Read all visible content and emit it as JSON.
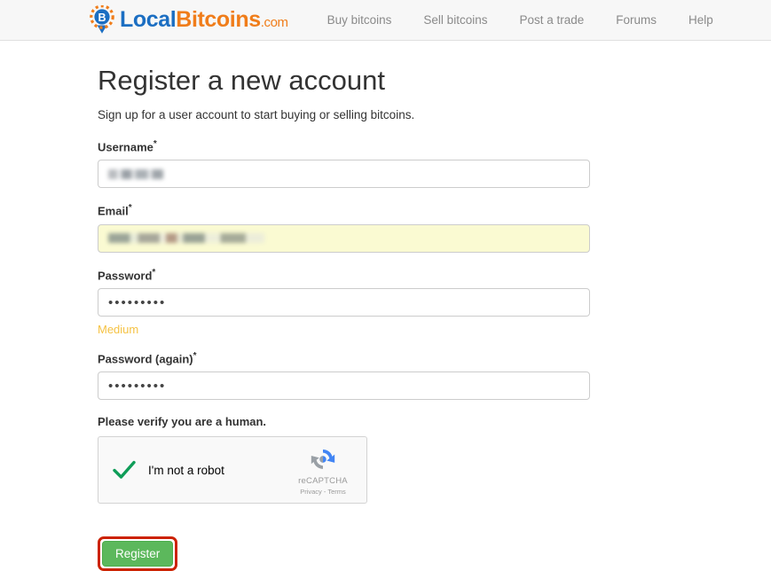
{
  "header": {
    "brand": {
      "logo_icon": "localbitcoins-pin-icon",
      "name_primary": "Local",
      "name_secondary": "Bitcoins",
      "tld": ".com",
      "color_primary": "#1b6ec2",
      "color_secondary": "#f07d1a"
    },
    "nav": [
      {
        "label": "Buy bitcoins"
      },
      {
        "label": "Sell bitcoins"
      },
      {
        "label": "Post a trade"
      },
      {
        "label": "Forums"
      },
      {
        "label": "Help"
      }
    ]
  },
  "page": {
    "title": "Register a new account",
    "subtitle": "Sign up for a user account to start buying or selling bitcoins."
  },
  "form": {
    "username": {
      "label": "Username",
      "required_marker": "*",
      "value": "",
      "value_state": "redacted",
      "redacted_width": 62
    },
    "email": {
      "label": "Email",
      "required_marker": "*",
      "value": "",
      "value_state": "redacted",
      "autofill": true,
      "autofill_color": "#fafad2",
      "redacted_width": 176
    },
    "password": {
      "label": "Password",
      "required_marker": "*",
      "value": "•••••••••",
      "strength_label": "Medium",
      "strength_color": "#f5c243"
    },
    "password_again": {
      "label": "Password (again)",
      "required_marker": "*",
      "value": "•••••••••"
    },
    "captcha": {
      "label": "Please verify you are a human.",
      "checkbox_text": "I'm not a robot",
      "checked": true,
      "check_color": "#0f9d58",
      "brand_name": "reCAPTCHA",
      "legal": "Privacy - Terms",
      "logo_icon": "recaptcha-circular-arrows-icon"
    },
    "submit": {
      "label": "Register",
      "color": "#5cb85c",
      "highlight_color": "#cc2200"
    }
  }
}
